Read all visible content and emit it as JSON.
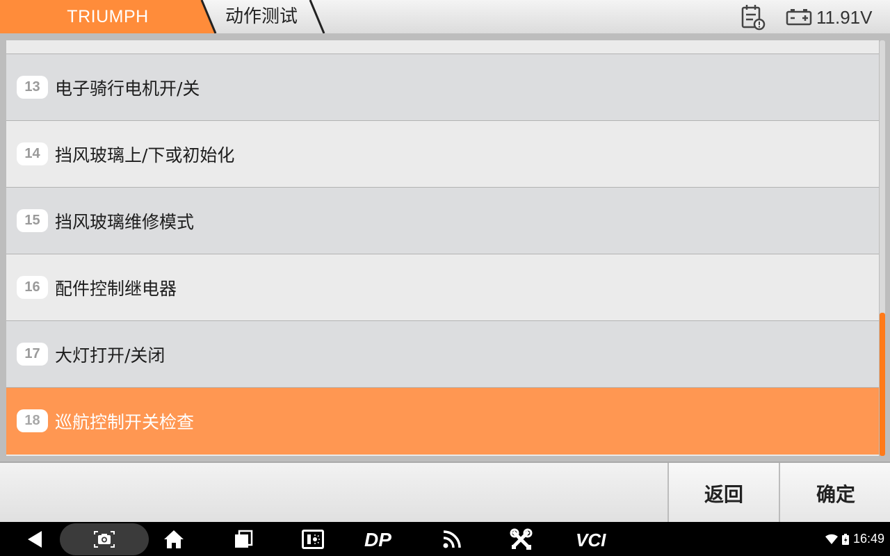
{
  "header": {
    "brand": "TRIUMPH",
    "page_title": "动作测试",
    "voltage": "11.91V",
    "icons": [
      "diagnostic-report-icon",
      "battery-icon"
    ],
    "brand_color": "#ff8c3a"
  },
  "list": {
    "items": [
      {
        "number": "13",
        "label": "电子骑行电机开/关",
        "selected": false
      },
      {
        "number": "14",
        "label": "挡风玻璃上/下或初始化",
        "selected": false
      },
      {
        "number": "15",
        "label": "挡风玻璃维修模式",
        "selected": false
      },
      {
        "number": "16",
        "label": "配件控制继电器",
        "selected": false
      },
      {
        "number": "17",
        "label": "大灯打开/关闭",
        "selected": false
      },
      {
        "number": "18",
        "label": "巡航控制开关检查",
        "selected": true
      }
    ],
    "selected_color": "#ff9752"
  },
  "footer": {
    "back_label": "返回",
    "confirm_label": "确定"
  },
  "navbar": {
    "icons": [
      "back-icon",
      "screenshot-icon",
      "home-icon",
      "recents-icon",
      "brightness-icon",
      "dp-icon",
      "rss-icon",
      "tools-icon",
      "vci-icon"
    ],
    "dp_label": "DP",
    "vci_label": "VCI",
    "time": "16:49"
  }
}
